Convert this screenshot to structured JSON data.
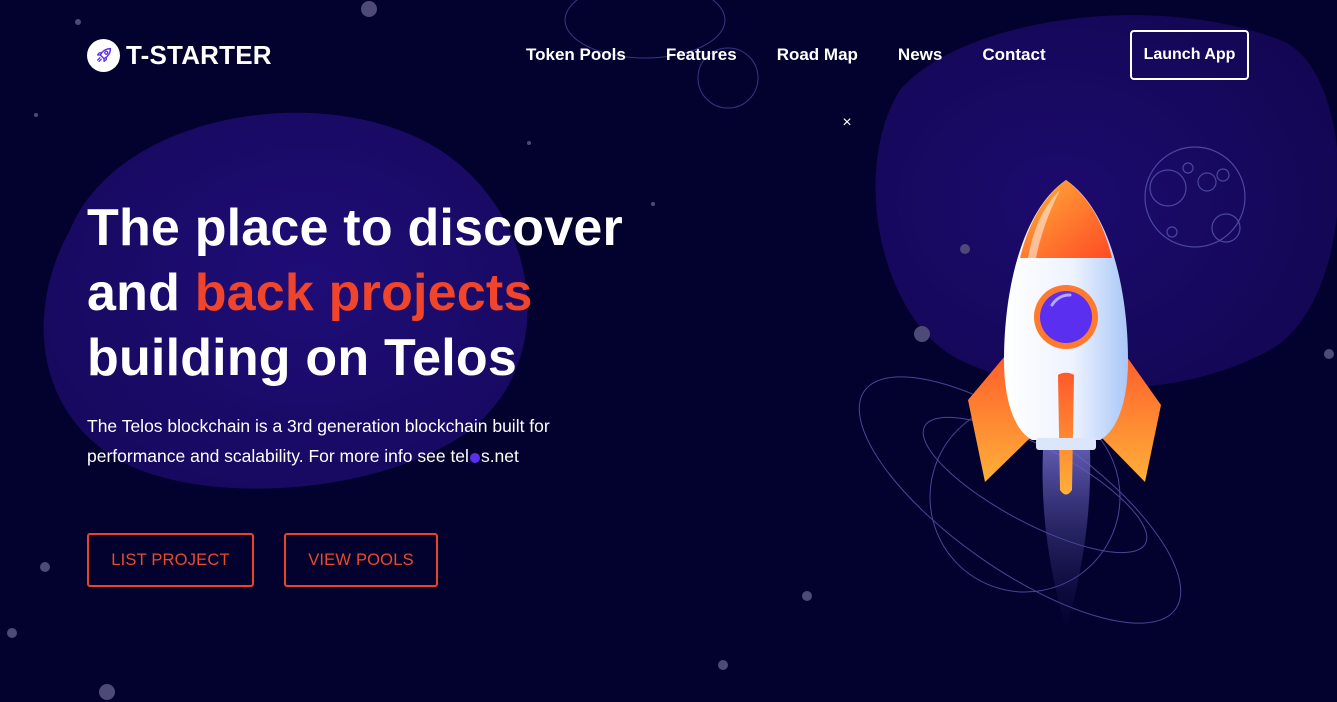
{
  "brand": {
    "name": "T-STARTER",
    "logo_icon": "rocket-icon"
  },
  "nav": {
    "items": [
      {
        "label": "Token Pools"
      },
      {
        "label": "Features"
      },
      {
        "label": "Road Map"
      },
      {
        "label": "News"
      },
      {
        "label": "Contact"
      }
    ],
    "launch_label": "Launch App"
  },
  "overlay": {
    "close_glyph": "×"
  },
  "hero": {
    "title_line1": "The place to discover",
    "title_line2_a": "and ",
    "title_line2_b": "back projects",
    "title_line3": "building on Telos",
    "desc_line1": "The Telos blockchain is a 3rd generation blockchain built for",
    "desc_line2_a": "performance and scalability. For more info see tel",
    "desc_line2_b": "s.net"
  },
  "actions": {
    "list_project": "LIST PROJECT",
    "view_pools": "VIEW POOLS"
  },
  "colors": {
    "background": "#03022e",
    "blob": "#1a0b6b",
    "accent": "#f0452b",
    "text": "#ffffff",
    "rocket_window": "#5a2ff0"
  },
  "illustration": {
    "rocket_icon": "rocket-illustration",
    "planet_icon": "moon-icon"
  }
}
